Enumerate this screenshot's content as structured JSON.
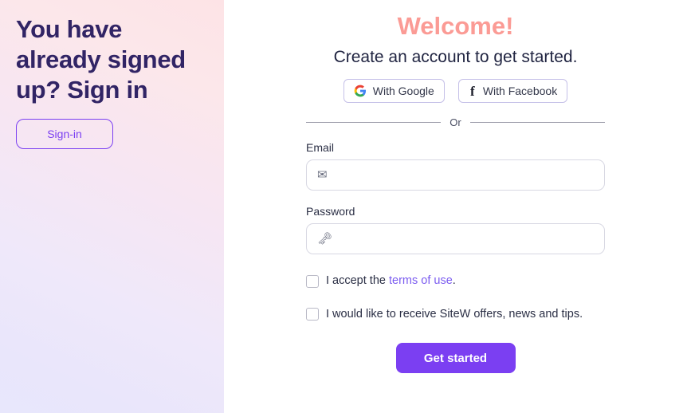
{
  "left_panel": {
    "heading": "You have already signed up? Sign in",
    "signin_label": "Sign-in",
    "gradient_from": "#e8e7fc",
    "gradient_to": "#fde3e6",
    "heading_color": "#312465",
    "accent_color": "#7b3ff2"
  },
  "right_panel": {
    "welcome_title": "Welcome!",
    "welcome_color": "#fb9b95",
    "subtitle": "Create an account to get started.",
    "social": {
      "google_label": "With Google",
      "google_icon": "google-g-icon",
      "facebook_label": "With Facebook",
      "facebook_icon": "facebook-f-icon",
      "facebook_glyph": "f"
    },
    "divider_text": "Or",
    "form": {
      "email_label": "Email",
      "email_value": "",
      "email_placeholder": "✉",
      "password_label": "Password",
      "password_value": "",
      "password_placeholder": "🗝",
      "terms": {
        "checked": false,
        "text_before": "I accept the ",
        "link_text": "terms of use",
        "text_after": ".",
        "link_color": "#7b5cf0"
      },
      "newsletter": {
        "checked": false,
        "text": "I would like to receive SiteW offers, news and tips."
      },
      "submit_label": "Get started",
      "submit_color": "#7b3ff2"
    }
  }
}
